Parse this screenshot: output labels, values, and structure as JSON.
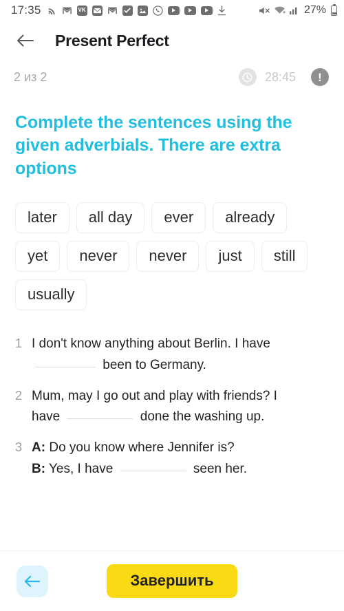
{
  "status_bar": {
    "time": "17:35",
    "battery_percent": "27%",
    "left_icons": [
      {
        "name": "rss-icon",
        "glyph": "⦷"
      },
      {
        "name": "gmail-icon",
        "glyph": "M"
      },
      {
        "name": "vk-icon",
        "glyph": "VK"
      },
      {
        "name": "mail-icon",
        "glyph": "✉"
      },
      {
        "name": "gmail-icon-2",
        "glyph": "M"
      },
      {
        "name": "checkbox-icon",
        "glyph": "✓"
      },
      {
        "name": "gallery-icon",
        "glyph": "☀"
      },
      {
        "name": "viber-icon",
        "glyph": "☎"
      },
      {
        "name": "youtube-icon-1",
        "glyph": "▶"
      },
      {
        "name": "youtube-icon-2",
        "glyph": "▶"
      },
      {
        "name": "youtube-icon-3",
        "glyph": "▶"
      },
      {
        "name": "download-icon",
        "glyph": "↓"
      }
    ],
    "right_icons": [
      {
        "name": "mute-icon"
      },
      {
        "name": "wifi-icon"
      },
      {
        "name": "signal-icon"
      },
      {
        "name": "battery-icon"
      }
    ]
  },
  "header": {
    "back_label": "←",
    "title": "Present Perfect"
  },
  "meta": {
    "counter": "2 из 2",
    "timer": "28:45",
    "warning_glyph": "!"
  },
  "task": {
    "instruction": "Complete the sentences using the given adverbials. There are extra options"
  },
  "options": [
    "later",
    "all day",
    "ever",
    "already",
    "yet",
    "never",
    "never",
    "just",
    "still",
    "usually"
  ],
  "questions": [
    {
      "number": "1",
      "line1_before": "I don't know anything about Berlin. I have",
      "line2_after": "been to Germany."
    },
    {
      "number": "2",
      "line1_before": "Mum, may I go out and play with friends? I",
      "line2_before": "have",
      "line2_after": "done the washing up."
    },
    {
      "number": "3",
      "speaker_a": "A:",
      "line_a": "Do you know where Jennifer is?",
      "speaker_b": "B:",
      "line_b_before": "Yes, I have",
      "line_b_after": "seen her."
    }
  ],
  "footer": {
    "nav_back_label": "←",
    "finish_label": "Завершить"
  },
  "colors": {
    "accent_cyan": "#22bede",
    "finish_yellow": "#fada14",
    "nav_back_bg": "#ddf4fd",
    "muted_gray": "#a6a6a6"
  }
}
